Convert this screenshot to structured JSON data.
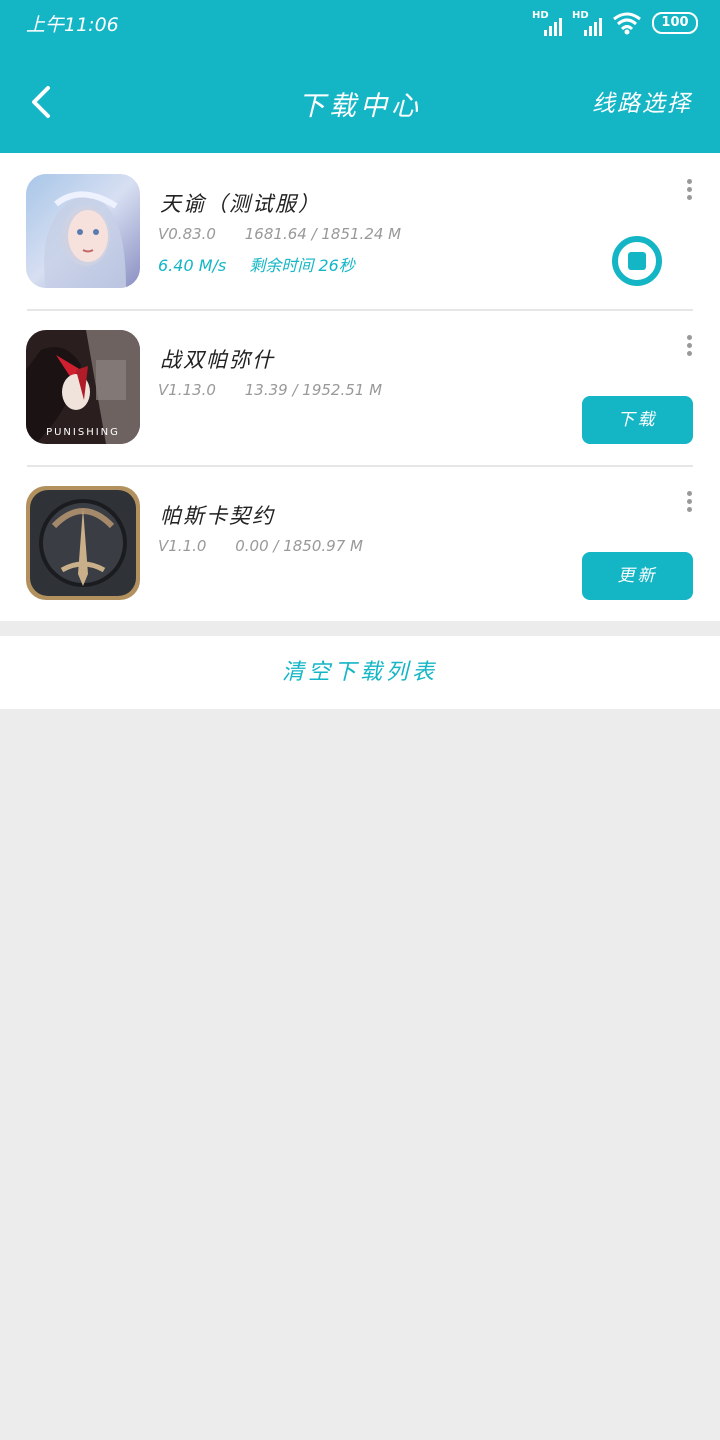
{
  "status_bar": {
    "time": "上午11:06",
    "signal_label": "HD",
    "battery": "100"
  },
  "header": {
    "title": "下载中心",
    "route_label": "线路选择"
  },
  "downloads": [
    {
      "name": "天谕（测试服）",
      "version": "V0.83.0",
      "progress": "1681.64 / 1851.24 M",
      "speed": "6.40 M/s",
      "remaining": "剩余时间 26秒",
      "action": "stop"
    },
    {
      "name": "战双帕弥什",
      "version": "V1.13.0",
      "progress": "13.39 / 1952.51 M",
      "action_label": "下载",
      "icon_caption": "PUNISHING"
    },
    {
      "name": "帕斯卡契约",
      "version": "V1.1.0",
      "progress": "0.00 / 1850.97 M",
      "action_label": "更新"
    }
  ],
  "footer": {
    "clear_label": "清空下载列表"
  },
  "colors": {
    "accent": "#14b6c6",
    "background": "#ececec"
  }
}
